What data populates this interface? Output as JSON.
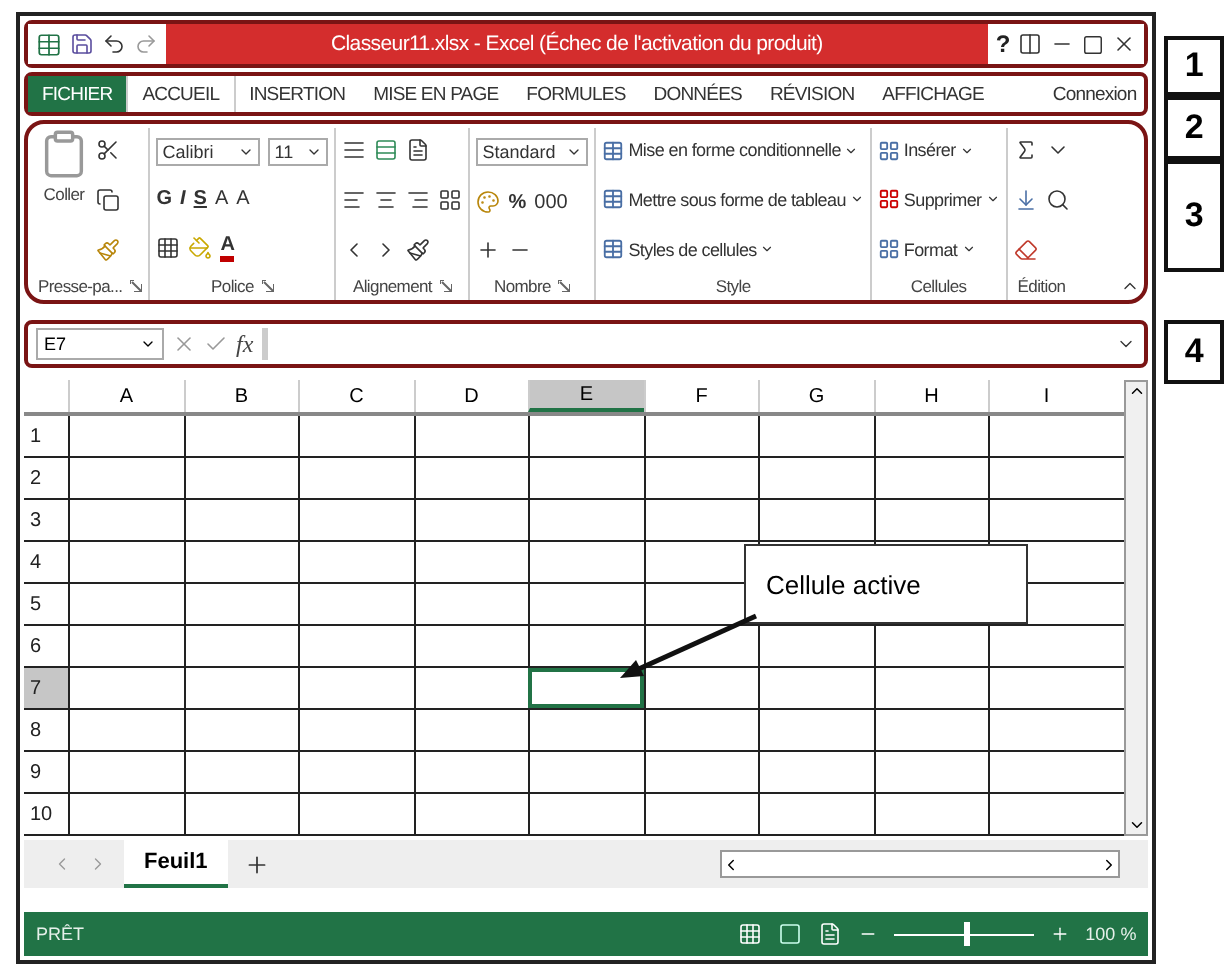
{
  "title_bar": {
    "title": "Classeur11.xlsx -  Excel (Échec de l'activation du produit)",
    "help": "?"
  },
  "ribbon_tabs": [
    {
      "label": "FICHIER",
      "kind": "file",
      "selected": false
    },
    {
      "label": "ACCUEIL",
      "kind": "tab",
      "selected": true
    },
    {
      "label": "INSERTION",
      "kind": "tab",
      "selected": false
    },
    {
      "label": "MISE EN PAGE",
      "kind": "tab",
      "selected": false
    },
    {
      "label": "FORMULES",
      "kind": "tab",
      "selected": false
    },
    {
      "label": "DONNÉES",
      "kind": "tab",
      "selected": false
    },
    {
      "label": "RÉVISION",
      "kind": "tab",
      "selected": false
    },
    {
      "label": "AFFICHAGE",
      "kind": "tab",
      "selected": false
    }
  ],
  "account": "Connexion",
  "ribbon": {
    "clipboard": {
      "paste": "Coller",
      "label": "Presse-pa..."
    },
    "font": {
      "name": "Calibri",
      "size": "11",
      "bold": "G",
      "italic": "I",
      "underline": "S",
      "grow": "A",
      "shrink": "A",
      "font_color_letter": "A",
      "label": "Police"
    },
    "alignment": {
      "label": "Alignement"
    },
    "number": {
      "format": "Standard",
      "percent": "%",
      "thousands": "000",
      "label": "Nombre"
    },
    "style": {
      "items": [
        "Mise en forme conditionnelle",
        "Mettre sous forme de tableau",
        "Styles de cellules"
      ],
      "label": "Style"
    },
    "cells": {
      "items": [
        "Insérer",
        "Supprimer",
        "Format"
      ],
      "label": "Cellules"
    },
    "editing": {
      "label": "Édition"
    }
  },
  "formula_bar": {
    "name_box": "E7",
    "fx": "fx"
  },
  "grid": {
    "columns": [
      {
        "label": "A",
        "selected": false
      },
      {
        "label": "B",
        "selected": false
      },
      {
        "label": "C",
        "selected": false
      },
      {
        "label": "D",
        "selected": false
      },
      {
        "label": "E",
        "selected": true
      },
      {
        "label": "F",
        "selected": false
      },
      {
        "label": "G",
        "selected": false
      },
      {
        "label": "H",
        "selected": false
      },
      {
        "label": "I",
        "selected": false
      }
    ],
    "rows": [
      {
        "label": "1",
        "selected": false
      },
      {
        "label": "2",
        "selected": false
      },
      {
        "label": "3",
        "selected": false
      },
      {
        "label": "4",
        "selected": false
      },
      {
        "label": "5",
        "selected": false
      },
      {
        "label": "6",
        "selected": false
      },
      {
        "label": "7",
        "selected": true
      },
      {
        "label": "8",
        "selected": false
      },
      {
        "label": "9",
        "selected": false
      },
      {
        "label": "10",
        "selected": false
      }
    ]
  },
  "sheet_tabs": [
    {
      "label": "Feuil1",
      "selected": true
    }
  ],
  "status_bar": {
    "status": "PRÊT",
    "zoom": "100 %",
    "level": 0.55
  },
  "annotations": {
    "callout": "Cellule active",
    "numbers": [
      "1",
      "2",
      "3",
      "4"
    ]
  }
}
